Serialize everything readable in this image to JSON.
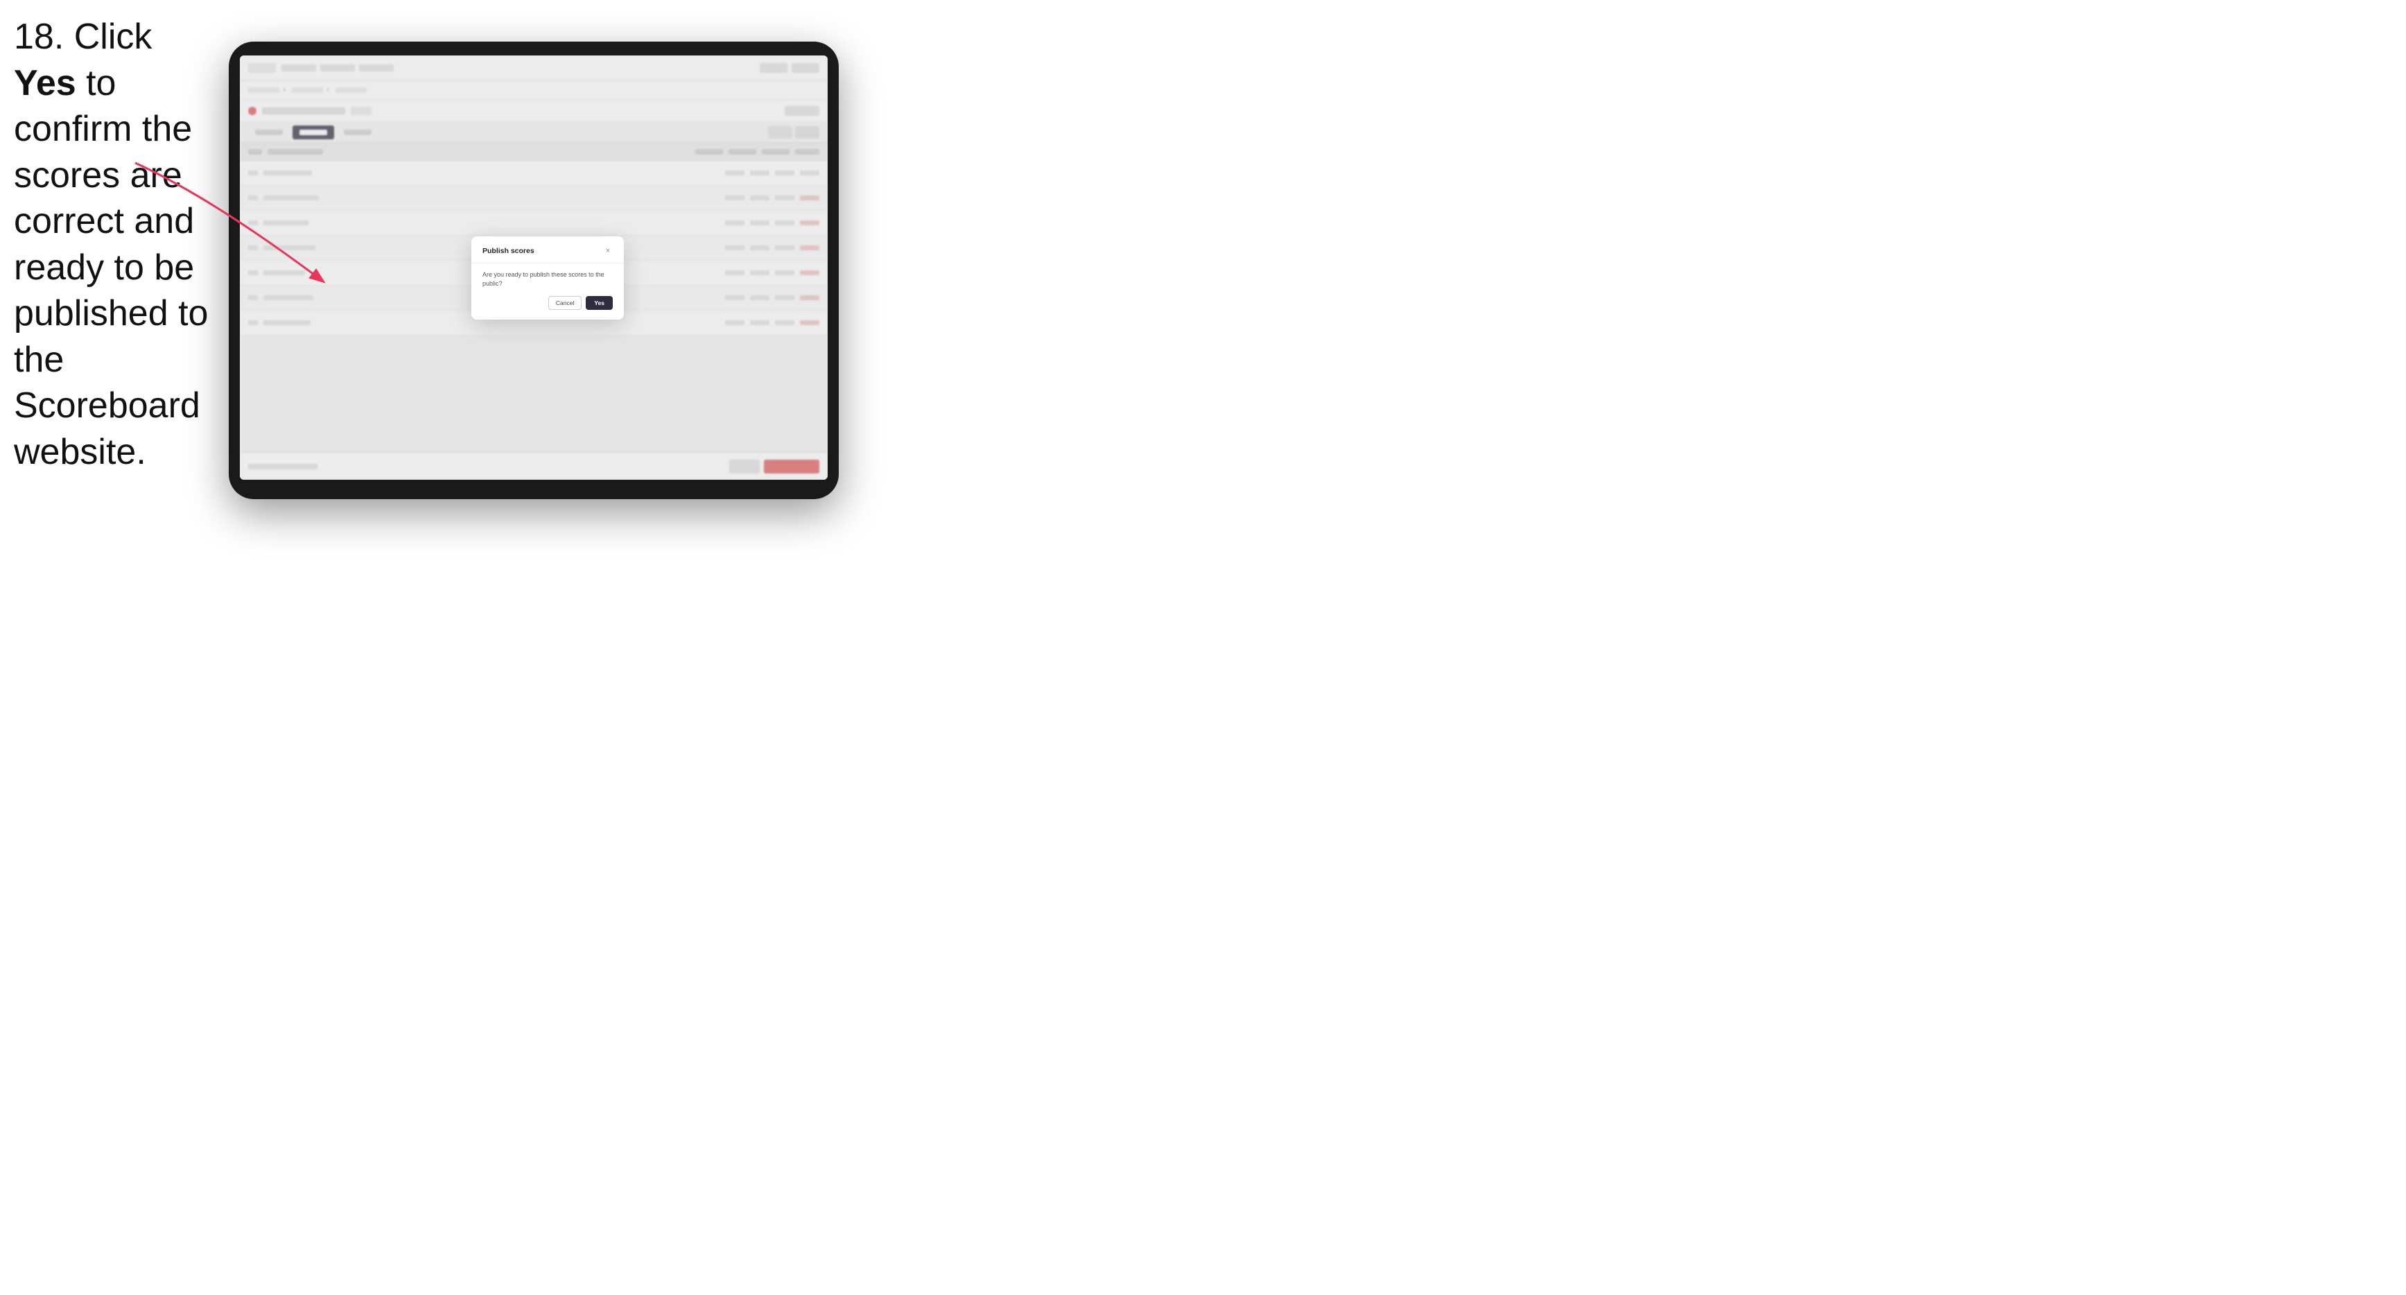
{
  "instruction": {
    "step_number": "18.",
    "text_before_bold": " Click ",
    "bold_word": "Yes",
    "text_after_bold": " to confirm the scores are correct and ready to be published to the Scoreboard website."
  },
  "dialog": {
    "title": "Publish scores",
    "message": "Are you ready to publish these scores to the public?",
    "cancel_label": "Cancel",
    "yes_label": "Yes",
    "close_icon": "×"
  },
  "colors": {
    "yes_button_bg": "#2d2d3f",
    "cancel_button_border": "#cccccc",
    "dialog_bg": "#ffffff",
    "arrow_color": "#e8355a"
  }
}
